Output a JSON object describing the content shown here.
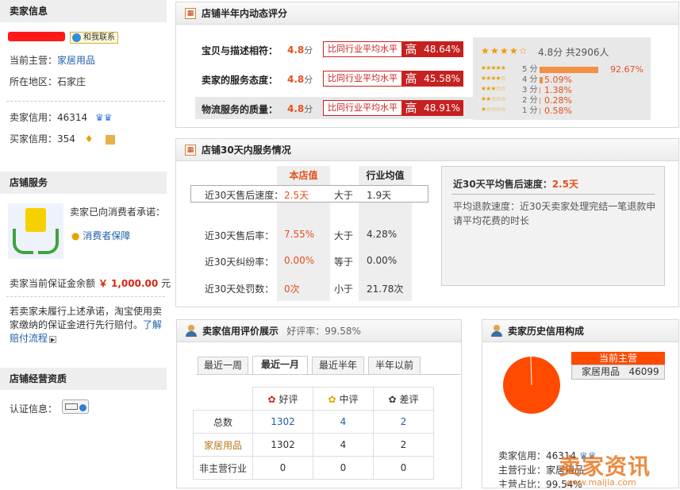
{
  "seller_info": {
    "header": "卖家信息",
    "contact_label": "和我联系",
    "main_business_label": "当前主营：",
    "main_business_value": "家居用品",
    "region_label": "所在地区：",
    "region_value": "石家庄",
    "seller_credit_label": "卖家信用：",
    "seller_credit_value": "46314",
    "buyer_credit_label": "买家信用：",
    "buyer_credit_value": "354"
  },
  "shop_service": {
    "header": "店铺服务",
    "promise_text": "卖家已向消费者承诺：",
    "guarantee_link": "消费者保障",
    "deposit_label": "卖家当前保证金余额",
    "deposit_value": "￥ 1,000.00",
    "deposit_unit": "元",
    "note_text": "若卖家未履行上述承诺，淘宝使用卖家缴纳的保证金进行先行赔付。",
    "note_link": "了解赔付流程"
  },
  "shop_qualification": {
    "header": "店铺经营资质",
    "cert_label": "认证信息："
  },
  "dynamic_rating": {
    "header": "店铺半年内动态评分",
    "rows": [
      {
        "label": "宝贝与描述相符：",
        "score": "4.8",
        "unit": "分",
        "compare": "比同行业平均水平",
        "hi": "高",
        "pct": "48.64%"
      },
      {
        "label": "卖家的服务态度：",
        "score": "4.8",
        "unit": "分",
        "compare": "比同行业平均水平",
        "hi": "高",
        "pct": "45.58%"
      },
      {
        "label": "物流服务的质量：",
        "score": "4.8",
        "unit": "分",
        "compare": "比同行业平均水平",
        "hi": "高",
        "pct": "48.91%"
      }
    ],
    "summary_score": "4.8分",
    "summary_count": "共2906人",
    "distribution": [
      {
        "label": "5 分",
        "pct": "92.67%",
        "value": 92.67
      },
      {
        "label": "4 分",
        "pct": "5.09%",
        "value": 5.09
      },
      {
        "label": "3 分",
        "pct": "1.38%",
        "value": 1.38
      },
      {
        "label": "2 分",
        "pct": "0.28%",
        "value": 0.28
      },
      {
        "label": "1 分",
        "pct": "0.58%",
        "value": 0.58
      }
    ]
  },
  "service_30d": {
    "header": "店铺30天内服务情况",
    "col_shop": "本店值",
    "col_industry": "行业均值",
    "rows": [
      {
        "label": "近30天售后速度：",
        "shop": "2.5天",
        "cmp": "大于",
        "industry": "1.9天"
      },
      {
        "label": "近30天售后率：",
        "shop": "7.55%",
        "cmp": "大于",
        "industry": "4.28%"
      },
      {
        "label": "近30天纠纷率：",
        "shop": "0.00%",
        "cmp": "等于",
        "industry": "0.00%"
      },
      {
        "label": "近30天处罚数：",
        "shop": "0次",
        "cmp": "小于",
        "industry": "21.78次"
      }
    ],
    "detail_title": "近30天平均售后速度：",
    "detail_value": "2.5天",
    "detail_desc": "平均退款速度：近30天卖家处理完结一笔退款申请平均花费的时长"
  },
  "credit_review": {
    "header": "卖家信用评价展示",
    "good_rate": "好评率：99.58%",
    "tabs": [
      "最近一周",
      "最近一月",
      "最近半年",
      "半年以前"
    ],
    "active_tab": 1,
    "columns": [
      "好评",
      "中评",
      "差评"
    ],
    "rows": [
      {
        "label": "总数",
        "values": [
          "1302",
          "4",
          "2"
        ]
      },
      {
        "label": "家居用品",
        "values": [
          "1302",
          "4",
          "2"
        ]
      },
      {
        "label": "非主营行业",
        "values": [
          "0",
          "0",
          "0"
        ]
      }
    ]
  },
  "credit_history": {
    "header": "卖家历史信用构成",
    "legend_title": "当前主营",
    "legend_name": "家居用品",
    "legend_value": "46099",
    "pie_share": 99.54,
    "seller_credit_label": "卖家信用：",
    "seller_credit_value": "46314",
    "main_industry_label": "主营行业：",
    "main_industry_value": "家居用品",
    "main_share_label": "主营占比：",
    "main_share_value": "99.54%",
    "watermark": "卖家资讯",
    "watermark_url": "www.maijia.com"
  }
}
